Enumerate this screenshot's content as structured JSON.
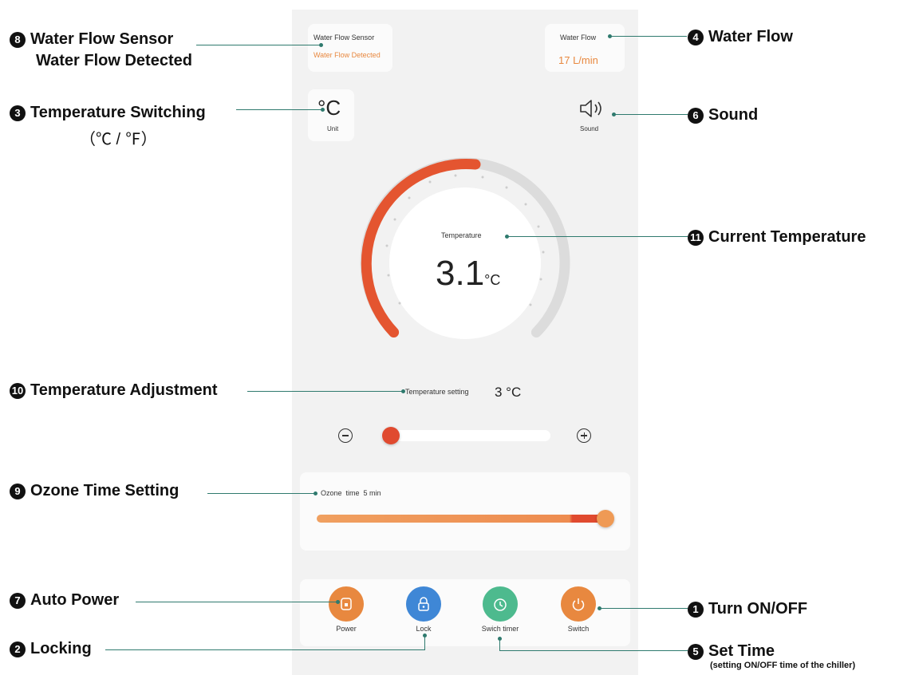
{
  "app": {
    "flow_sensor": {
      "title": "Water Flow Sensor",
      "status": "Water Flow Detected"
    },
    "water_flow": {
      "title": "Water Flow",
      "value": "17 L/min"
    },
    "unit": {
      "symbol": "°C",
      "label": "Unit"
    },
    "sound": {
      "label": "Sound"
    },
    "temperature": {
      "label": "Temperature",
      "value": "3.1",
      "unit": "°C"
    },
    "setting": {
      "label": "Temperature setting",
      "value": "3 °C"
    },
    "ozone": {
      "label": "Ozone  time  5 min",
      "level": 1.0
    },
    "buttons": [
      {
        "label": "Power",
        "color": "#e8883f",
        "icon": "power-plug-icon"
      },
      {
        "label": "Lock",
        "color": "#3f87d6",
        "icon": "lock-icon"
      },
      {
        "label": "Swich timer",
        "color": "#4dba8e",
        "icon": "timer-icon"
      },
      {
        "label": "Switch",
        "color": "#e8883f",
        "icon": "power-icon"
      }
    ]
  },
  "callouts": {
    "c8": {
      "num": "8",
      "line1": "Water Flow Sensor",
      "line2": "Water Flow Detected"
    },
    "c3": {
      "num": "3",
      "line1": "Temperature Switching",
      "line2": "（℃ / ℉）"
    },
    "c10": {
      "num": "10",
      "text": "Temperature Adjustment"
    },
    "c9": {
      "num": "9",
      "text": "Ozone Time Setting"
    },
    "c7": {
      "num": "7",
      "text": "Auto Power"
    },
    "c2": {
      "num": "2",
      "text": "Locking"
    },
    "c4": {
      "num": "4",
      "text": "Water Flow"
    },
    "c6": {
      "num": "6",
      "text": "Sound"
    },
    "c11": {
      "num": "11",
      "text": "Current Temperature"
    },
    "c1": {
      "num": "1",
      "text": "Turn ON/OFF"
    },
    "c5": {
      "num": "5",
      "text": "Set Time",
      "sub": "(setting ON/OFF time of the chiller)"
    }
  },
  "colors": {
    "accent_orange": "#e8883f",
    "accent_red": "#e04a2f",
    "leader_line": "#2f7a6e"
  }
}
